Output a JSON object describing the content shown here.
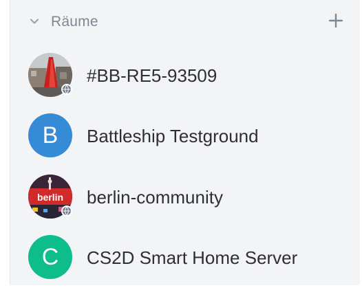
{
  "section": {
    "title": "Räume",
    "chevron_icon": "chevron-down-icon",
    "add_icon": "plus-icon"
  },
  "rooms": [
    {
      "name": "#BB-RE5-93509",
      "avatar_type": "image",
      "avatar_icon": "room-photo-avatar",
      "badge_icon": "globe-icon"
    },
    {
      "name": "Battleship Testground",
      "avatar_type": "letter",
      "avatar_letter": "B",
      "avatar_color": "#368bd6"
    },
    {
      "name": "berlin-community",
      "avatar_type": "image",
      "avatar_icon": "berlin-avatar",
      "avatar_text": "berlin",
      "badge_icon": "globe-icon"
    },
    {
      "name": "CS2D Smart Home Server",
      "avatar_type": "letter",
      "avatar_letter": "C",
      "avatar_color": "#0dbd8b"
    }
  ],
  "colors": {
    "panel_background": "#f3f4f6",
    "section_title": "#7d8894",
    "room_name": "#2e2f32"
  }
}
